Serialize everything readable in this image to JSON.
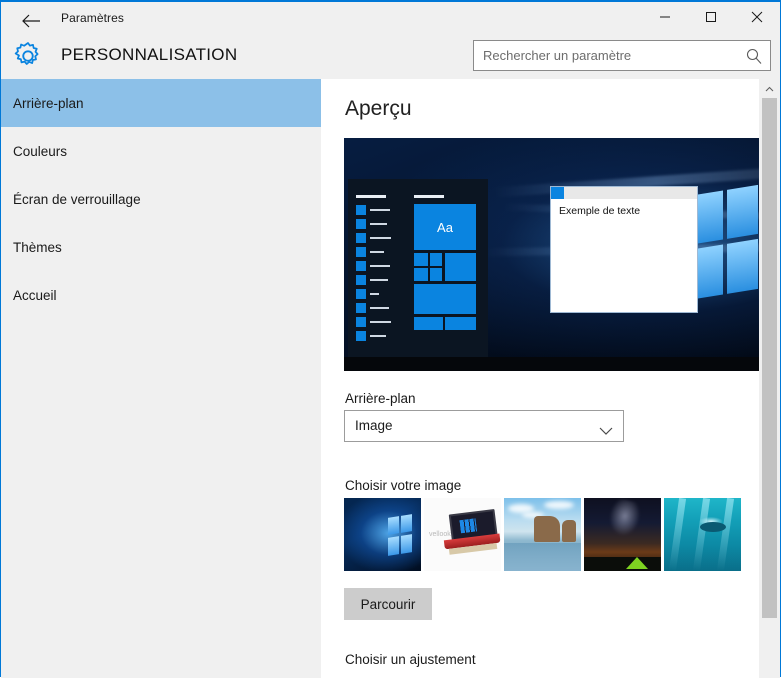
{
  "window": {
    "title": "Paramètres",
    "back_icon": "back-arrow-icon",
    "minimize_label": "—",
    "maximize_label": "□",
    "close_label": "✕"
  },
  "header": {
    "gear_icon": "gear-icon",
    "category_title": "PERSONNALISATION",
    "search": {
      "placeholder": "Rechercher un paramètre",
      "value": "",
      "icon": "search-icon"
    }
  },
  "sidebar": {
    "items": [
      {
        "label": "Arrière-plan",
        "selected": true
      },
      {
        "label": "Couleurs",
        "selected": false
      },
      {
        "label": "Écran de verrouillage",
        "selected": false
      },
      {
        "label": "Thèmes",
        "selected": false
      },
      {
        "label": "Accueil",
        "selected": false
      }
    ]
  },
  "main": {
    "page_title": "Aperçu",
    "preview": {
      "start_menu_tile_label": "Aa",
      "sample_window_text": "Exemple de texte"
    },
    "background_label": "Arrière-plan",
    "background_dropdown": {
      "value": "Image",
      "chevron_icon": "chevron-down-icon"
    },
    "choose_image_label": "Choisir votre image",
    "thumbnails": [
      {
        "name": "windows-hero-wallpaper"
      },
      {
        "name": "laptop-product-image"
      },
      {
        "name": "beach-rock-arch-photo"
      },
      {
        "name": "night-sky-tent-photo"
      },
      {
        "name": "underwater-diver-photo"
      }
    ],
    "browse_button": "Parcourir",
    "choose_fit_label": "Choisir un ajustement"
  },
  "scrollbar": {
    "up_arrow_icon": "chevron-up-icon"
  },
  "colors": {
    "accent": "#0078d7",
    "selected_nav": "#8cc0e8",
    "chrome": "#f0f0f0",
    "tile_blue": "#0a84e0",
    "button_gray": "#cccccc"
  }
}
